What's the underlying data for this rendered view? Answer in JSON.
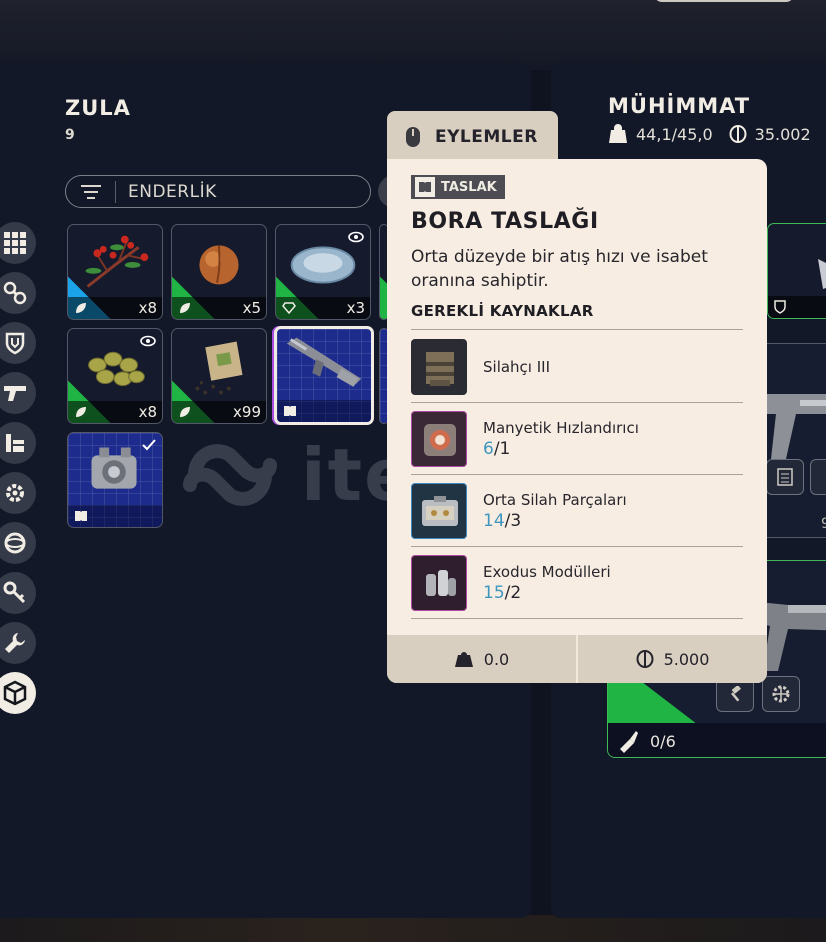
{
  "stash": {
    "title": "ZULA",
    "count": "9",
    "filter_label": "ENDERLİK"
  },
  "sidebar": {
    "items": [
      {
        "icon": "grid-icon"
      },
      {
        "icon": "attachments-icon"
      },
      {
        "icon": "shield-icon"
      },
      {
        "icon": "weapon-icon"
      },
      {
        "icon": "books-icon"
      },
      {
        "icon": "gear-icon"
      },
      {
        "icon": "ring-icon"
      },
      {
        "icon": "key-icon"
      },
      {
        "icon": "wrench-icon"
      },
      {
        "icon": "cube-icon",
        "active": true
      }
    ]
  },
  "inventory": {
    "slots": [
      {
        "item": "berry-branch",
        "qty": "x8",
        "rarity_color": "#1aa3e8"
      },
      {
        "item": "peach",
        "qty": "x5",
        "rarity_color": "#1fb443"
      },
      {
        "item": "stone-bowl",
        "qty": "x3",
        "rarity_color": "#1fb443"
      },
      {
        "item": "olives",
        "qty": "x8",
        "rarity_color": "#1fb443"
      },
      {
        "item": "seed-packet",
        "qty": "x99",
        "rarity_color": "#1fb443"
      },
      {
        "item": "bora-blueprint",
        "qty": ""
      },
      {
        "item": "engine-blueprint",
        "qty": ""
      }
    ]
  },
  "watermark": {
    "text": "item"
  },
  "ammo": {
    "title": "MÜHİMMAT",
    "weight": "44,1/45,0",
    "coins": "35.002",
    "ammo_count": "0/6",
    "side_value": "9"
  },
  "actions": {
    "label": "EYLEMLER"
  },
  "tooltip": {
    "badge": "TASLAK",
    "title": "BORA TASLAĞI",
    "description": "Orta düzeyde bir atış hızı ve isabet oranına sahiptir.",
    "required_heading": "GEREKLİ KAYNAKLAR",
    "resources": [
      {
        "name": "Silahçı III",
        "have": "",
        "need": ""
      },
      {
        "name": "Manyetik Hızlandırıcı",
        "have": "6",
        "need": "/1"
      },
      {
        "name": "Orta Silah Parçaları",
        "have": "14",
        "need": "/3"
      },
      {
        "name": "Exodus Modülleri",
        "have": "15",
        "need": "/2"
      }
    ],
    "weight": "0.0",
    "price": "5.000"
  },
  "colors": {
    "accent_blue": "#3f96bf",
    "panel_bg": "#121828",
    "tooltip_bg": "#f8ede2",
    "green": "#1fb443"
  }
}
